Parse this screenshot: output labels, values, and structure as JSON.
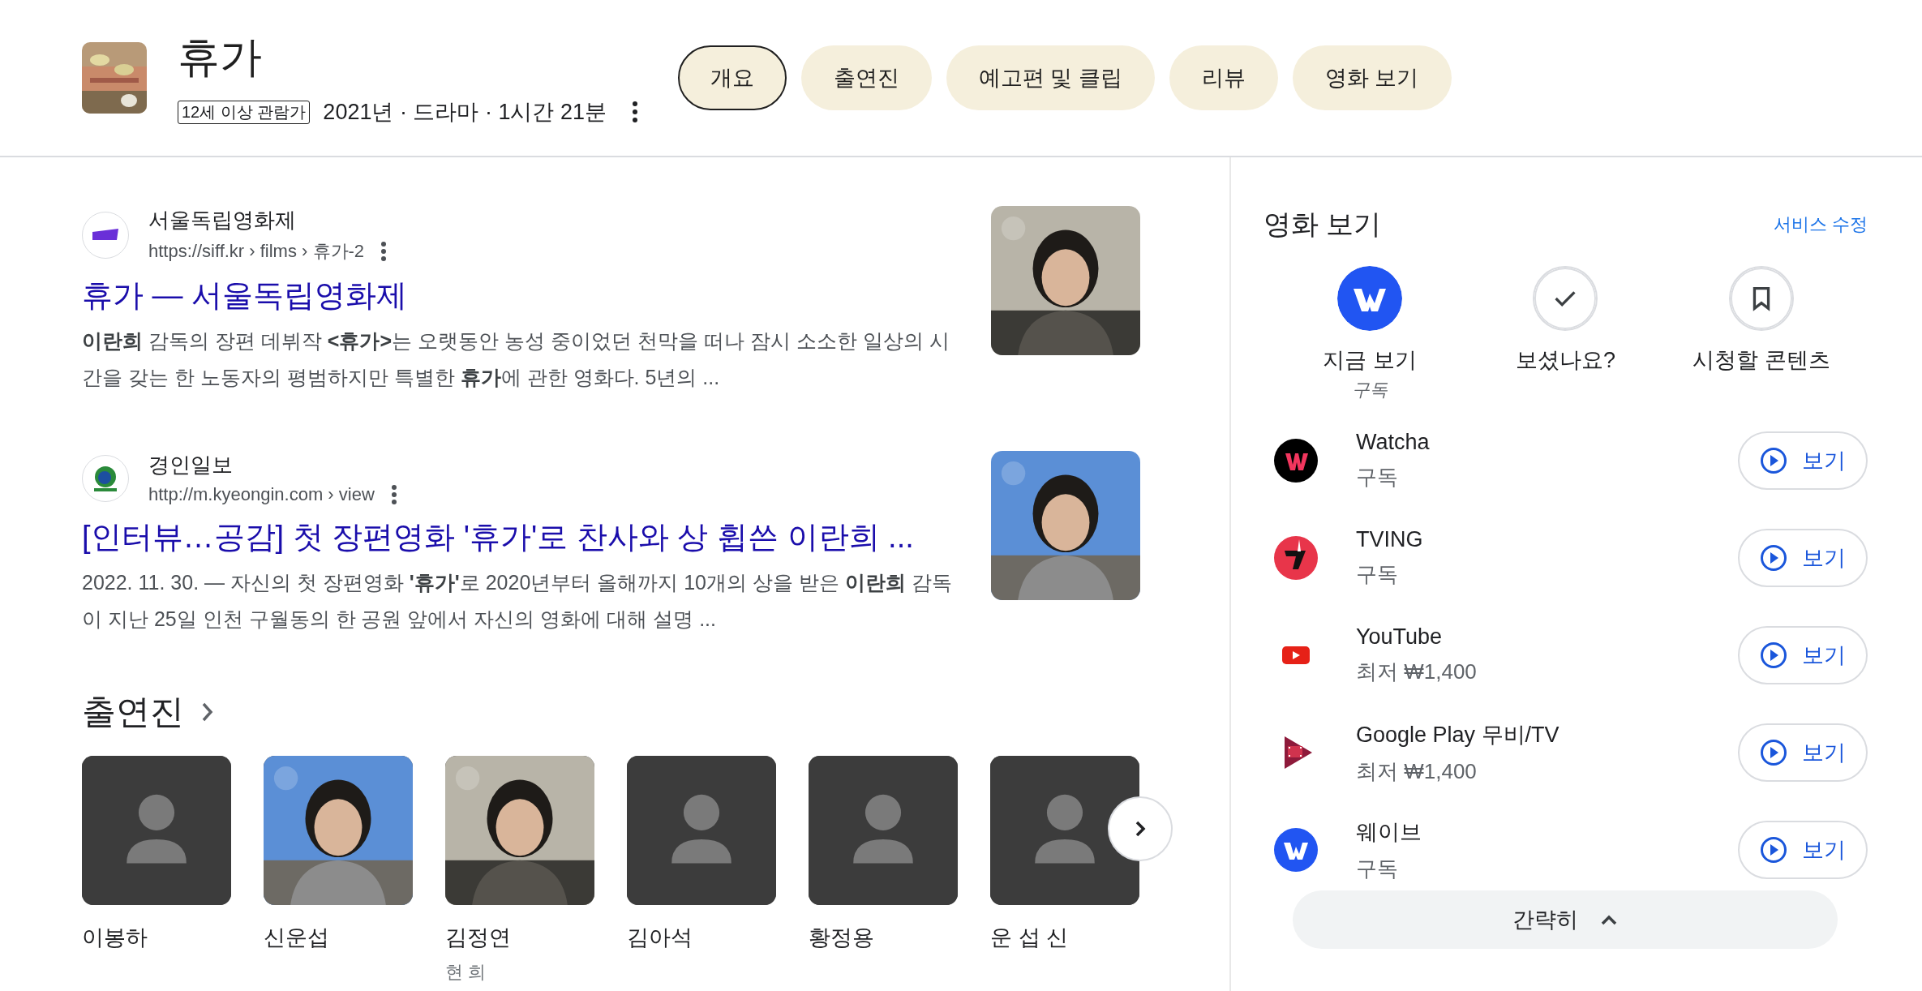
{
  "header": {
    "title": "휴가",
    "rating": "12세 이상 관람가",
    "meta": "2021년 · 드라마 · 1시간 21분",
    "tabs": [
      {
        "label": "개요",
        "selected": true
      },
      {
        "label": "출연진",
        "selected": false
      },
      {
        "label": "예고편 및 클립",
        "selected": false
      },
      {
        "label": "리뷰",
        "selected": false
      },
      {
        "label": "영화 보기",
        "selected": false
      }
    ]
  },
  "results": [
    {
      "source": "서울독립영화제",
      "url": "https://siff.kr › films › 휴가-2",
      "title": "휴가 — 서울독립영화제",
      "snippet": "**이란희** 감독의 장편 데뷔작 **<휴가>**는 오랫동안 농성 중이었던 천막을 떠나 잠시 소소한 일상의 시간을 갖는 한 노동자의 평범하지만 특별한 **휴가**에 관한 영화다. 5년의 ..."
    },
    {
      "source": "경인일보",
      "url": "http://m.kyeongin.com › view",
      "title": "[인터뷰…공감] 첫 장편영화 '휴가'로 찬사와 상 휩쓴 이란희 ...",
      "snippet": "2022. 11. 30. — 자신의 첫 장편영화 **'휴가'**로 2020년부터 올해까지 10개의 상을 받은 **이란희** 감독이 지난 25일 인천 구월동의 한 공원 앞에서 자신의 영화에 대해 설명 ..."
    }
  ],
  "cast": {
    "heading": "출연진",
    "members": [
      {
        "name": "이봉하",
        "kind": "placeholder"
      },
      {
        "name": "신운섭"
      },
      {
        "name": "김정연",
        "role": "현 희"
      },
      {
        "name": "김아석",
        "kind": "placeholder"
      },
      {
        "name": "황정용",
        "kind": "placeholder"
      },
      {
        "name": "운 섭 신",
        "kind": "placeholder"
      }
    ]
  },
  "watch": {
    "title": "영화 보기",
    "edit_link": "서비스 수정",
    "actions": [
      {
        "label": "지금 보기",
        "sub": "구독"
      },
      {
        "label": "보셨나요?"
      },
      {
        "label": "시청할 콘텐츠"
      }
    ],
    "providers": [
      {
        "name": "Watcha",
        "note": "구독",
        "button": "보기"
      },
      {
        "name": "TVING",
        "note": "구독",
        "button": "보기"
      },
      {
        "name": "YouTube",
        "note": "최저 ₩1,400",
        "button": "보기"
      },
      {
        "name": "Google Play 무비/TV",
        "note": "최저 ₩1,400",
        "button": "보기"
      },
      {
        "name": "웨이브",
        "note": "구독",
        "button": "보기"
      }
    ],
    "collapse_button": "간략히"
  }
}
